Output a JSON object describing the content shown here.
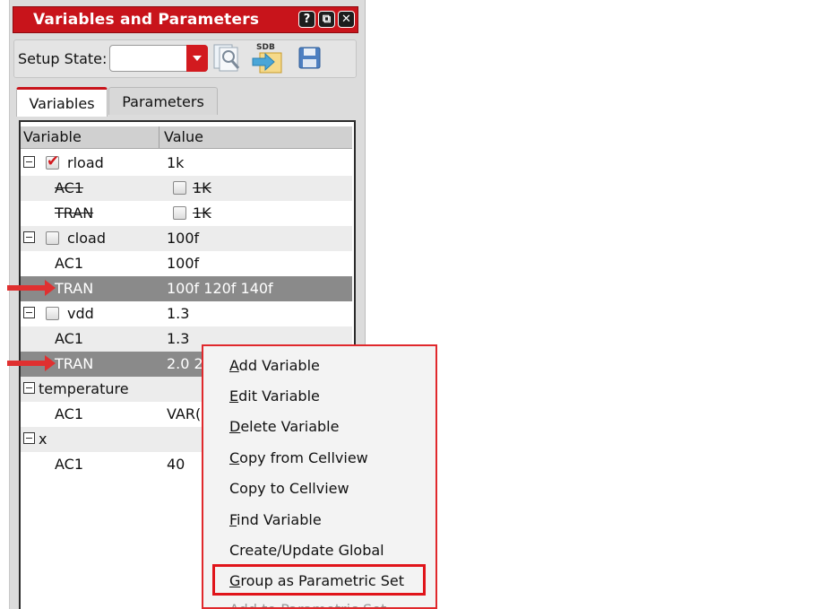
{
  "panel": {
    "title": "Variables and Parameters",
    "title_buttons": [
      "?",
      "⧉",
      "✕"
    ]
  },
  "toolbar": {
    "setup_state_label": "Setup State:",
    "setup_state_value": "",
    "icons": [
      "load-state-icon",
      "sdb-icon",
      "save-icon"
    ],
    "sdb_label": "SDB"
  },
  "tabs": [
    {
      "label": "Variables",
      "active": true
    },
    {
      "label": "Parameters",
      "active": false
    }
  ],
  "table": {
    "headers": {
      "variable": "Variable",
      "value": "Value"
    },
    "rows": [
      {
        "name": "rload",
        "value": "1k",
        "level": 0,
        "expander": true,
        "checkbox": true,
        "checked": true,
        "struck": false,
        "selected": false
      },
      {
        "name": "AC1",
        "value": "1K",
        "level": 1,
        "expander": false,
        "checkbox": false,
        "value_checkbox": true,
        "struck": true,
        "selected": false
      },
      {
        "name": "TRAN",
        "value": "1K",
        "level": 1,
        "expander": false,
        "checkbox": false,
        "value_checkbox": true,
        "struck": true,
        "selected": false
      },
      {
        "name": "cload",
        "value": "100f",
        "level": 0,
        "expander": true,
        "checkbox": true,
        "checked": false,
        "struck": false,
        "selected": false
      },
      {
        "name": "AC1",
        "value": "100f",
        "level": 1,
        "expander": false,
        "checkbox": false,
        "struck": false,
        "selected": false
      },
      {
        "name": "TRAN",
        "value": "100f 120f 140f",
        "level": 1,
        "expander": false,
        "checkbox": false,
        "struck": false,
        "selected": true
      },
      {
        "name": "vdd",
        "value": "1.3",
        "level": 0,
        "expander": true,
        "checkbox": true,
        "checked": false,
        "struck": false,
        "selected": false
      },
      {
        "name": "AC1",
        "value": "1.3",
        "level": 1,
        "expander": false,
        "checkbox": false,
        "struck": false,
        "selected": false
      },
      {
        "name": "TRAN",
        "value": "2.0 2",
        "level": 1,
        "expander": false,
        "checkbox": false,
        "struck": false,
        "selected": true
      },
      {
        "name": "temperature",
        "value": "",
        "level": 0,
        "expander": true,
        "checkbox": false,
        "struck": false,
        "selected": false
      },
      {
        "name": "AC1",
        "value": "VAR(",
        "level": 1,
        "expander": false,
        "checkbox": false,
        "struck": false,
        "selected": false
      },
      {
        "name": "x",
        "value": "",
        "level": 0,
        "expander": true,
        "checkbox": false,
        "struck": false,
        "selected": false
      },
      {
        "name": "AC1",
        "value": "40",
        "level": 1,
        "expander": false,
        "checkbox": false,
        "struck": false,
        "selected": false
      }
    ]
  },
  "context_menu": {
    "items": [
      {
        "mnemonic": "A",
        "rest": "dd Variable"
      },
      {
        "mnemonic": "E",
        "rest": "dit Variable"
      },
      {
        "mnemonic": "D",
        "rest": "elete Variable"
      },
      {
        "mnemonic": "C",
        "rest": "opy from Cellview"
      },
      {
        "mnemonic": "",
        "rest": "Copy to Cellview"
      },
      {
        "mnemonic": "F",
        "rest": "ind Variable"
      },
      {
        "mnemonic": "",
        "rest": "Create/Update Global"
      },
      {
        "mnemonic": "G",
        "rest": "roup as Parametric Set"
      },
      {
        "mnemonic": "",
        "rest": "Add to Parametric Set"
      }
    ],
    "highlighted_item": "Group as Parametric Set"
  },
  "colors": {
    "accent_red": "#c8141b",
    "selected_row": "#8a8a8a",
    "annotation_red": "#e0282c"
  }
}
